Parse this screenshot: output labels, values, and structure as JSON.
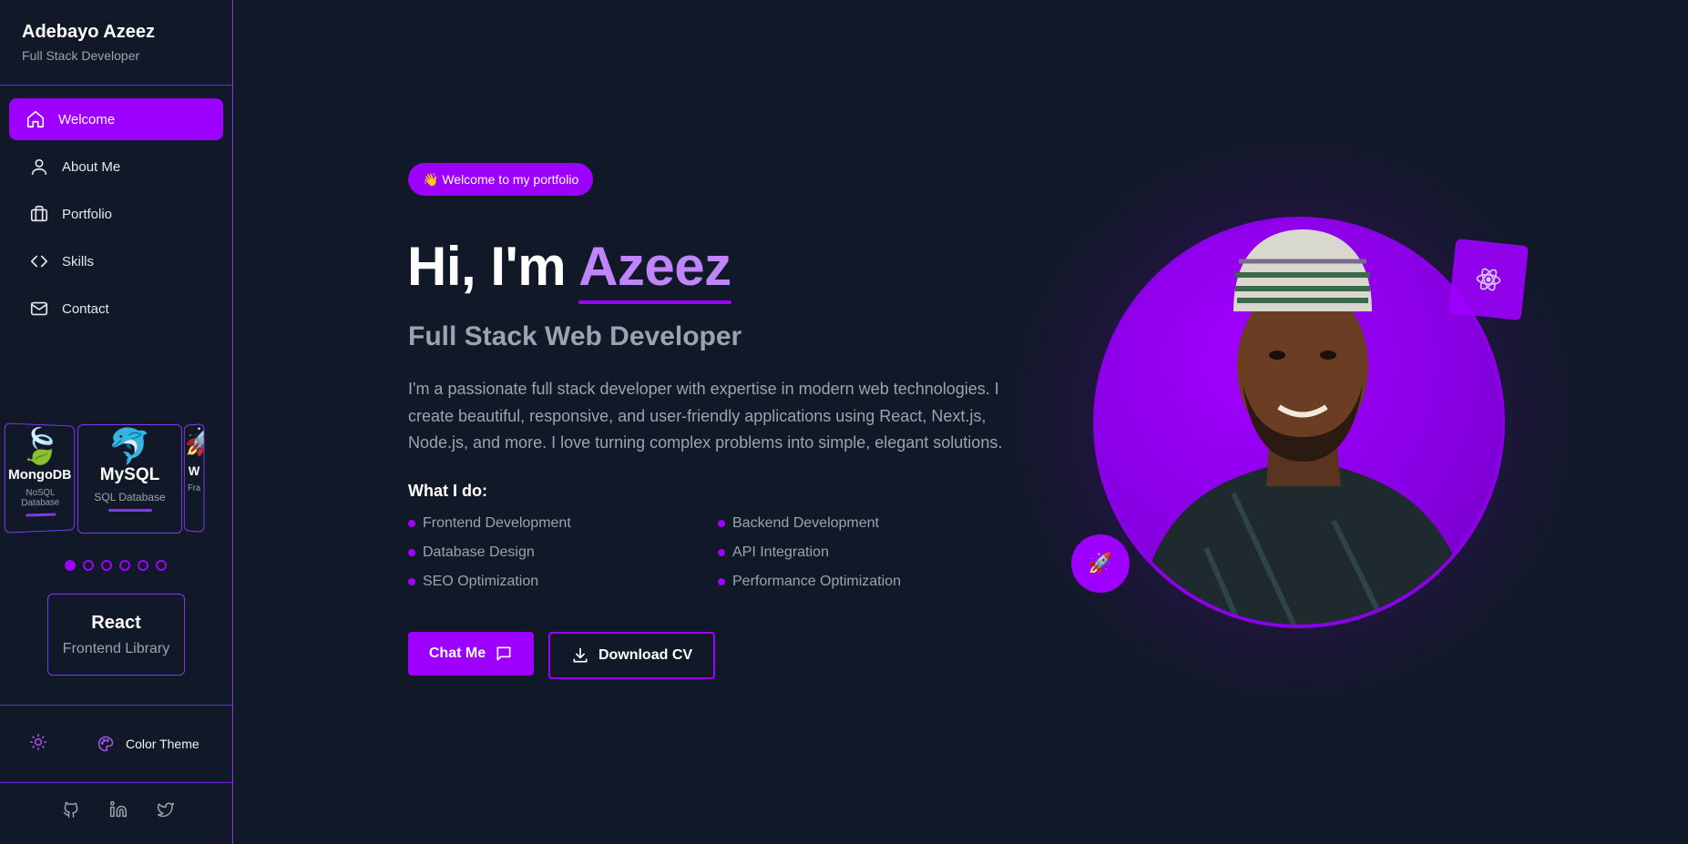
{
  "sidebar": {
    "name": "Adebayo Azeez",
    "role": "Full Stack Developer",
    "nav": [
      {
        "label": "Welcome",
        "icon": "home-icon",
        "active": true
      },
      {
        "label": "About Me",
        "icon": "user-icon"
      },
      {
        "label": "Portfolio",
        "icon": "briefcase-icon"
      },
      {
        "label": "Skills",
        "icon": "code-icon"
      },
      {
        "label": "Contact",
        "icon": "mail-icon"
      }
    ],
    "carousel": [
      {
        "title": "MongoDB",
        "subtitle": "NoSQL Database",
        "emoji": "🍃"
      },
      {
        "title": "MySQL",
        "subtitle": "SQL Database",
        "emoji": "🐬"
      },
      {
        "title": "W",
        "subtitle": "Fra",
        "emoji": "🚀"
      }
    ],
    "carousel_dots": 6,
    "carousel_active_dot": 0,
    "current_tech": {
      "name": "React",
      "kind": "Frontend Library"
    },
    "theme_label": "Color Theme",
    "socials": [
      "github-icon",
      "linkedin-icon",
      "twitter-icon"
    ]
  },
  "hero": {
    "badge": "👋 Welcome to my portfolio",
    "greeting": "Hi, I'm",
    "name": "Azeez",
    "subtitle": "Full Stack Web Developer",
    "bio": "I'm a passionate full stack developer with expertise in modern web technologies. I create beautiful, responsive, and user-friendly applications using React, Next.js, Node.js, and more. I love turning complex problems into simple, elegant solutions.",
    "what_title": "What I do:",
    "skills": [
      "Frontend Development",
      "Backend Development",
      "Database Design",
      "API Integration",
      "SEO Optimization",
      "Performance Optimization"
    ],
    "chat_label": "Chat Me",
    "cv_label": "Download CV"
  },
  "avatar": {
    "float_top_icon": "atom-icon",
    "float_bottom_icon": "🚀"
  },
  "colors": {
    "accent": "#9d00ff",
    "accent_light": "#c084fc",
    "background": "#111827",
    "muted_text": "#9ca3af"
  }
}
